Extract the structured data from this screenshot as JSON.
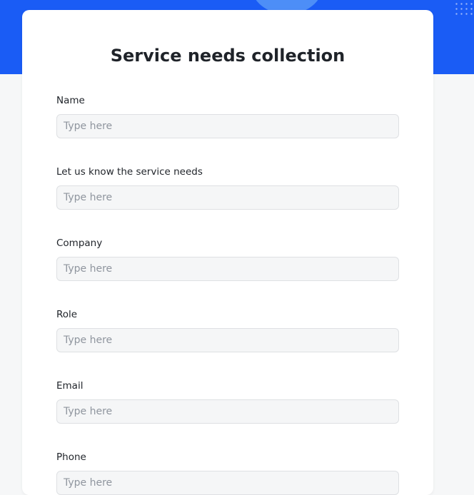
{
  "form": {
    "title": "Service needs collection",
    "fields": [
      {
        "label": "Name",
        "placeholder": "Type here",
        "value": ""
      },
      {
        "label": "Let us know the service needs",
        "placeholder": "Type here",
        "value": ""
      },
      {
        "label": "Company",
        "placeholder": "Type here",
        "value": ""
      },
      {
        "label": "Role",
        "placeholder": "Type here",
        "value": ""
      },
      {
        "label": "Email",
        "placeholder": "Type here",
        "value": ""
      },
      {
        "label": "Phone",
        "placeholder": "Type here",
        "value": ""
      }
    ]
  },
  "colors": {
    "banner": "#1a5cf5",
    "page_background": "#f6f7f8",
    "card_background": "#ffffff"
  }
}
